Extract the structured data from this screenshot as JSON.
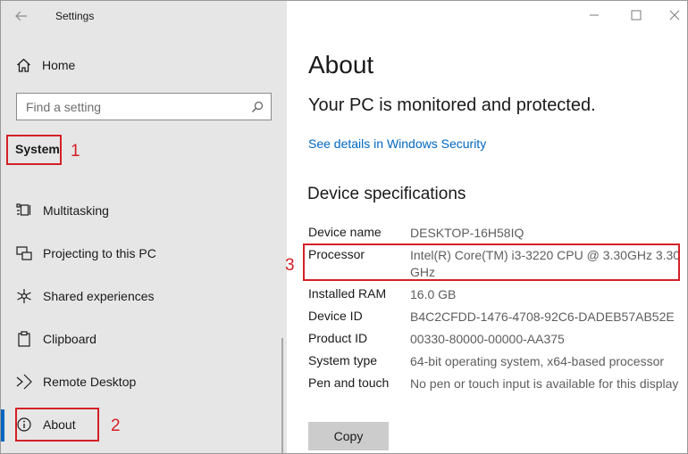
{
  "window": {
    "app_title": "Settings",
    "controls": {
      "minimize": "minimize",
      "maximize": "maximize",
      "close": "close"
    }
  },
  "sidebar": {
    "home_label": "Home",
    "search_placeholder": "Find a setting",
    "section_label": "System",
    "items": [
      {
        "label": "Multitasking",
        "icon": "multitasking-icon"
      },
      {
        "label": "Projecting to this PC",
        "icon": "projecting-icon"
      },
      {
        "label": "Shared experiences",
        "icon": "shared-experiences-icon"
      },
      {
        "label": "Clipboard",
        "icon": "clipboard-icon"
      },
      {
        "label": "Remote Desktop",
        "icon": "remote-desktop-icon"
      },
      {
        "label": "About",
        "icon": "info-icon",
        "selected": true
      }
    ]
  },
  "annotations": [
    "1",
    "2",
    "3"
  ],
  "main": {
    "title": "About",
    "protection_status": "Your PC is monitored and protected.",
    "security_link": "See details in Windows Security",
    "section_title": "Device specifications",
    "specs": [
      {
        "key": "Device name",
        "value": "DESKTOP-16H58IQ"
      },
      {
        "key": "Processor",
        "value": "Intel(R) Core(TM) i3-3220 CPU @ 3.30GHz   3.30 GHz"
      },
      {
        "key": "Installed RAM",
        "value": "16.0 GB"
      },
      {
        "key": "Device ID",
        "value": "B4C2CFDD-1476-4708-92C6-DADEB57AB52E"
      },
      {
        "key": "Product ID",
        "value": "00330-80000-00000-AA375"
      },
      {
        "key": "System type",
        "value": "64-bit operating system, x64-based processor"
      },
      {
        "key": "Pen and touch",
        "value": "No pen or touch input is available for this display"
      }
    ],
    "copy_label": "Copy"
  },
  "colors": {
    "sidebar_bg": "#e6e6e6",
    "accent": "#0067c0",
    "annotation": "#d42027",
    "button_bg": "#cccccc"
  }
}
